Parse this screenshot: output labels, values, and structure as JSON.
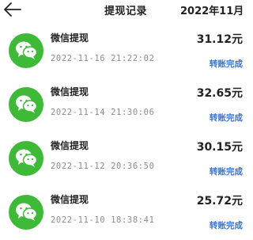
{
  "header": {
    "back_icon": "arrow-left-icon",
    "title": "提现记录",
    "month": "2022年11月"
  },
  "records": [
    {
      "name": "微信提现",
      "time": "2022-11-16 21:22:02",
      "amount": "31.12元",
      "status": "转账完成",
      "icon": "wechat-icon"
    },
    {
      "name": "微信提现",
      "time": "2022-11-14 21:30:06",
      "amount": "32.65元",
      "status": "转账完成",
      "icon": "wechat-icon"
    },
    {
      "name": "微信提现",
      "time": "2022-11-12 20:36:50",
      "amount": "30.15元",
      "status": "转账完成",
      "icon": "wechat-icon"
    },
    {
      "name": "微信提现",
      "time": "2022-11-10 18:38:41",
      "amount": "25.72元",
      "status": "转账完成",
      "icon": "wechat-icon"
    }
  ],
  "colors": {
    "wechat_green": "#3fb938",
    "status_blue": "#3b74c8",
    "time_gray": "#8c8c8c"
  }
}
